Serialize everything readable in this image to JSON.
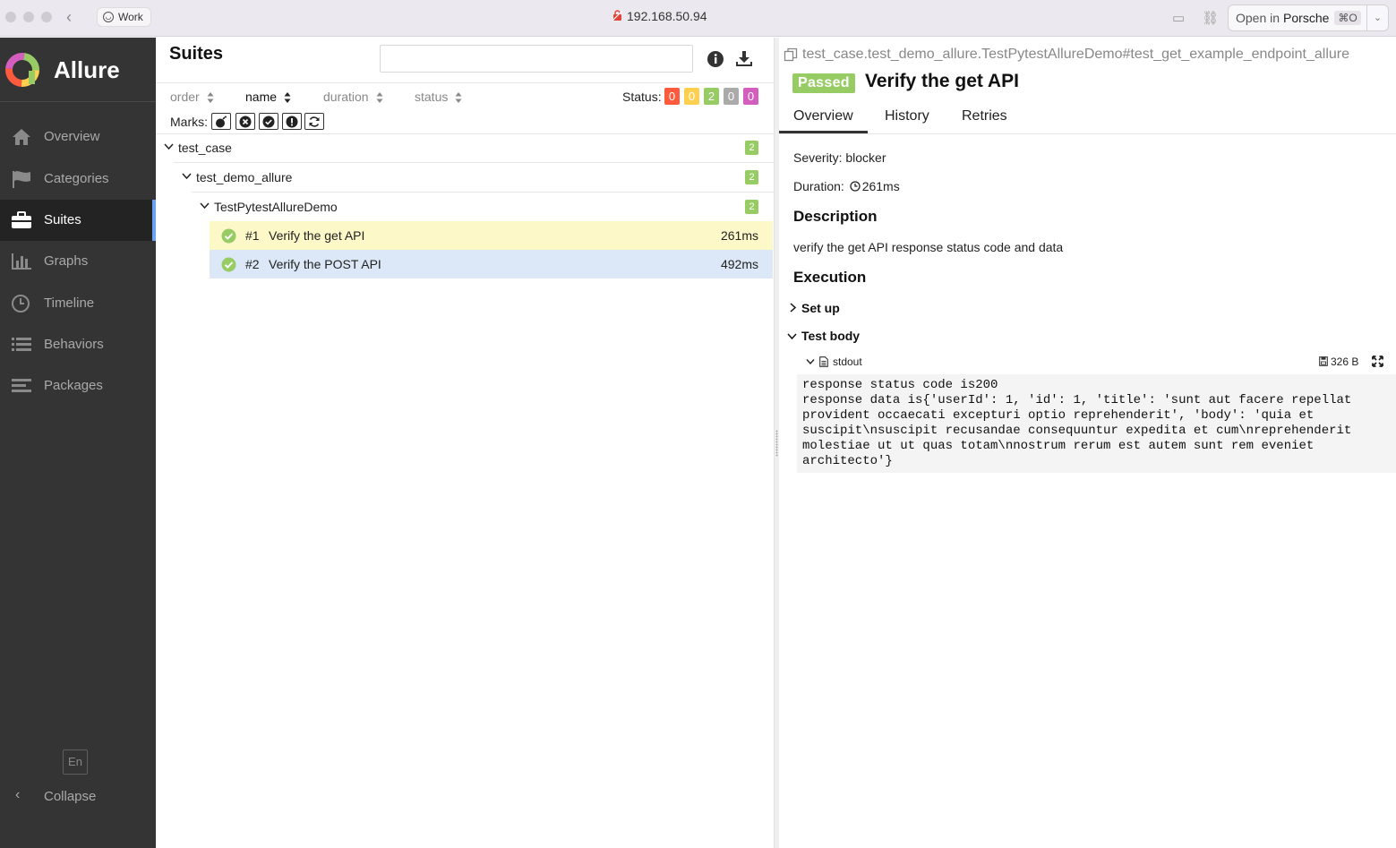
{
  "browser": {
    "profile_label": "Work",
    "address": "192.168.50.94",
    "open_in_prefix": "Open in",
    "open_in_app": "Porsche",
    "open_in_shortcut": "⌘O"
  },
  "sidebar": {
    "brand": "Allure",
    "items": [
      {
        "label": "Overview",
        "icon": "home-icon"
      },
      {
        "label": "Categories",
        "icon": "flag-icon"
      },
      {
        "label": "Suites",
        "icon": "briefcase-icon",
        "active": true
      },
      {
        "label": "Graphs",
        "icon": "bar-chart-icon"
      },
      {
        "label": "Timeline",
        "icon": "clock-icon"
      },
      {
        "label": "Behaviors",
        "icon": "list-icon"
      },
      {
        "label": "Packages",
        "icon": "align-left-icon"
      }
    ],
    "language": "En",
    "collapse_label": "Collapse"
  },
  "suites": {
    "title": "Suites",
    "search_value": "",
    "sort": [
      {
        "label": "order",
        "active": false
      },
      {
        "label": "name",
        "active": true
      },
      {
        "label": "duration",
        "active": false
      },
      {
        "label": "status",
        "active": false
      }
    ],
    "status_label": "Status:",
    "status_counts": [
      {
        "value": "0",
        "color": "#fd5a3e"
      },
      {
        "value": "0",
        "color": "#ffd050"
      },
      {
        "value": "2",
        "color": "#97cc64"
      },
      {
        "value": "0",
        "color": "#aaaaaa"
      },
      {
        "value": "0",
        "color": "#d35ebe"
      }
    ],
    "marks_label": "Marks:",
    "marks": [
      "bomb-icon",
      "times-circle-icon",
      "check-circle-icon",
      "info-circle-icon",
      "refresh-icon"
    ],
    "tree": [
      {
        "label": "test_case",
        "count": "2"
      },
      {
        "label": "test_demo_allure",
        "count": "2"
      },
      {
        "label": "TestPytestAllureDemo",
        "count": "2"
      }
    ],
    "cases": [
      {
        "num": "#1",
        "title": "Verify the get API",
        "duration": "261ms"
      },
      {
        "num": "#2",
        "title": "Verify the POST API",
        "duration": "492ms"
      }
    ]
  },
  "testcase": {
    "full_path": "test_case.test_demo_allure.TestPytestAllureDemo#test_get_example_endpoint_allure",
    "status": "Passed",
    "title": "Verify the get API",
    "tabs": [
      "Overview",
      "History",
      "Retries"
    ],
    "severity": "Severity: blocker",
    "duration_label": "Duration:",
    "duration_value": "261ms",
    "description_heading": "Description",
    "description": "verify the get API response status code and data",
    "execution_heading": "Execution",
    "setup_label": "Set up",
    "body_label": "Test body",
    "attachment_name": "stdout",
    "attachment_size": "326 B",
    "stdout": "response status code is200\nresponse data is{'userId': 1, 'id': 1, 'title': 'sunt aut facere repellat\nprovident occaecati excepturi optio reprehenderit', 'body': 'quia et\nsuscipit\\nsuscipit recusandae consequuntur expedita et cum\\nreprehenderit\nmolestiae ut ut quas totam\\nnostrum rerum est autem sunt rem eveniet\narchitecto'}"
  }
}
